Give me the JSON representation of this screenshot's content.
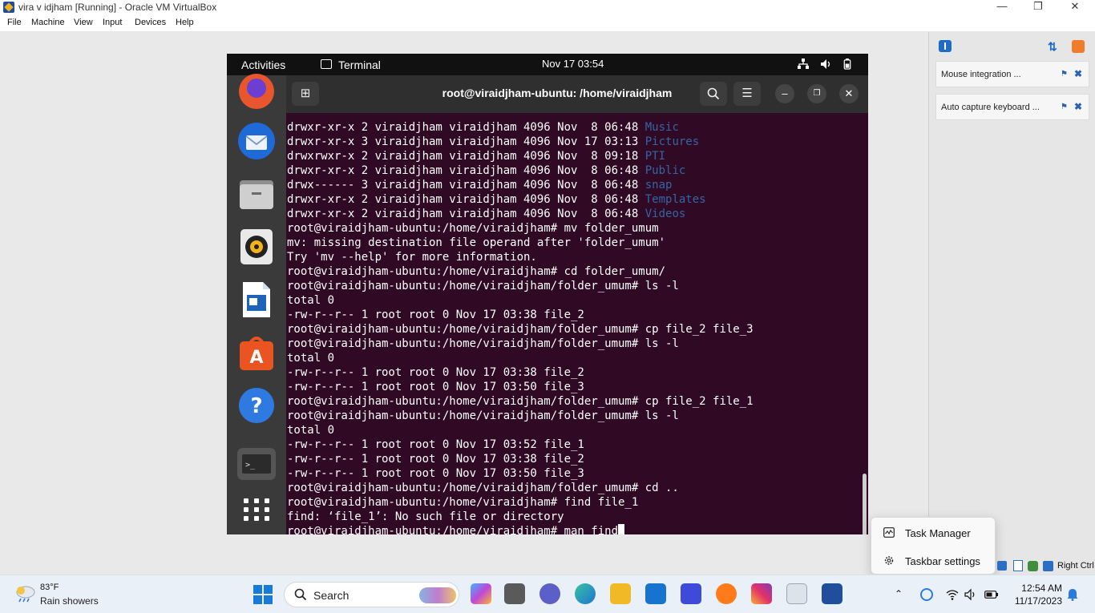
{
  "vbox": {
    "title": "vira v idjham  [Running] - Oracle VM VirtualBox",
    "menu": [
      "File",
      "Machine",
      "View",
      "Input",
      "Devices",
      "Help"
    ],
    "notifications": [
      {
        "label": "Mouse integration ..."
      },
      {
        "label": "Auto capture keyboard ..."
      }
    ],
    "status_right_ctrl": "Right Ctrl"
  },
  "ubuntu": {
    "activities": "Activities",
    "app_name": "Terminal",
    "clock": "Nov 17  03:54"
  },
  "terminal": {
    "title": "root@viraidjham-ubuntu: /home/viraidjham",
    "lines": [
      {
        "prefix": "drwxr-xr-x 2 viraidjham viraidjham 4096 Nov  8 06:48 ",
        "dir": "Music"
      },
      {
        "prefix": "drwxr-xr-x 3 viraidjham viraidjham 4096 Nov 17 03:13 ",
        "dir": "Pictures"
      },
      {
        "prefix": "drwxrwxr-x 2 viraidjham viraidjham 4096 Nov  8 09:18 ",
        "dir": "PTI"
      },
      {
        "prefix": "drwxr-xr-x 2 viraidjham viraidjham 4096 Nov  8 06:48 ",
        "dir": "Public"
      },
      {
        "prefix": "drwx------ 3 viraidjham viraidjham 4096 Nov  8 06:48 ",
        "dir": "snap"
      },
      {
        "prefix": "drwxr-xr-x 2 viraidjham viraidjham 4096 Nov  8 06:48 ",
        "dir": "Templates"
      },
      {
        "prefix": "drwxr-xr-x 2 viraidjham viraidjham 4096 Nov  8 06:48 ",
        "dir": "Videos"
      },
      {
        "prefix": "root@viraidjham-ubuntu:/home/viraidjham# mv folder_umum",
        "dir": ""
      },
      {
        "prefix": "mv: missing destination file operand after 'folder_umum'",
        "dir": ""
      },
      {
        "prefix": "Try 'mv --help' for more information.",
        "dir": ""
      },
      {
        "prefix": "root@viraidjham-ubuntu:/home/viraidjham# cd folder_umum/",
        "dir": ""
      },
      {
        "prefix": "root@viraidjham-ubuntu:/home/viraidjham/folder_umum# ls -l",
        "dir": ""
      },
      {
        "prefix": "total 0",
        "dir": ""
      },
      {
        "prefix": "-rw-r--r-- 1 root root 0 Nov 17 03:38 file_2",
        "dir": ""
      },
      {
        "prefix": "root@viraidjham-ubuntu:/home/viraidjham/folder_umum# cp file_2 file_3",
        "dir": ""
      },
      {
        "prefix": "root@viraidjham-ubuntu:/home/viraidjham/folder_umum# ls -l",
        "dir": ""
      },
      {
        "prefix": "total 0",
        "dir": ""
      },
      {
        "prefix": "-rw-r--r-- 1 root root 0 Nov 17 03:38 file_2",
        "dir": ""
      },
      {
        "prefix": "-rw-r--r-- 1 root root 0 Nov 17 03:50 file_3",
        "dir": ""
      },
      {
        "prefix": "root@viraidjham-ubuntu:/home/viraidjham/folder_umum# cp file_2 file_1",
        "dir": ""
      },
      {
        "prefix": "root@viraidjham-ubuntu:/home/viraidjham/folder_umum# ls -l",
        "dir": ""
      },
      {
        "prefix": "total 0",
        "dir": ""
      },
      {
        "prefix": "-rw-r--r-- 1 root root 0 Nov 17 03:52 file_1",
        "dir": ""
      },
      {
        "prefix": "-rw-r--r-- 1 root root 0 Nov 17 03:38 file_2",
        "dir": ""
      },
      {
        "prefix": "-rw-r--r-- 1 root root 0 Nov 17 03:50 file_3",
        "dir": ""
      },
      {
        "prefix": "root@viraidjham-ubuntu:/home/viraidjham/folder_umum# cd ..",
        "dir": ""
      },
      {
        "prefix": "root@viraidjham-ubuntu:/home/viraidjham# find file_1",
        "dir": ""
      },
      {
        "prefix": "find: ‘file_1’: No such file or directory",
        "dir": ""
      },
      {
        "prefix": "root@viraidjham-ubuntu:/home/viraidjham# man find",
        "dir": ""
      }
    ]
  },
  "context_menu": {
    "items": [
      "Task Manager",
      "Taskbar settings"
    ]
  },
  "taskbar": {
    "weather_temp": "83°F",
    "weather_desc": "Rain showers",
    "search_label": "Search",
    "time": "12:54 AM",
    "date": "11/17/2023"
  },
  "colors": {
    "terminal_bg": "#300a24",
    "dir_blue": "#3465a4",
    "windows_accent": "#1a7ad9"
  }
}
